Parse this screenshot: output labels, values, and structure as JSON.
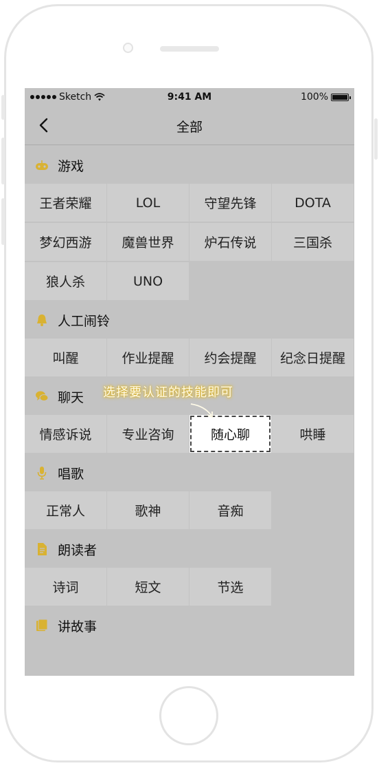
{
  "status_bar": {
    "carrier": "Sketch",
    "time": "9:41 AM",
    "battery": "100%"
  },
  "nav": {
    "title": "全部",
    "back_icon": "chevron-left-icon"
  },
  "annotation": {
    "text": "选择要认证的技能即可"
  },
  "colors": {
    "accent": "#d9b232",
    "screen_bg": "#c3c3c3",
    "cell_bg": "#cecece",
    "selected_bg": "#ffffff"
  },
  "sections": [
    {
      "id": "games",
      "icon": "gamepad-icon",
      "title": "游戏",
      "items": [
        "王者荣耀",
        "LOL",
        "守望先锋",
        "DOTA",
        "梦幻西游",
        "魔兽世界",
        "炉石传说",
        "三国杀",
        "狼人杀",
        "UNO"
      ]
    },
    {
      "id": "alarm",
      "icon": "bell-icon",
      "title": "人工闹铃",
      "items": [
        "叫醒",
        "作业提醒",
        "约会提醒",
        "纪念日提醒"
      ]
    },
    {
      "id": "chat",
      "icon": "chat-bubble-icon",
      "title": "聊天",
      "items": [
        "情感诉说",
        "专业咨询",
        "随心聊",
        "哄睡"
      ],
      "selected": "随心聊"
    },
    {
      "id": "sing",
      "icon": "microphone-icon",
      "title": "唱歌",
      "items": [
        "正常人",
        "歌神",
        "音痴"
      ]
    },
    {
      "id": "reader",
      "icon": "document-icon",
      "title": "朗读者",
      "items": [
        "诗词",
        "短文",
        "节选"
      ]
    },
    {
      "id": "story",
      "icon": "book-icon",
      "title": "讲故事",
      "items": []
    }
  ]
}
